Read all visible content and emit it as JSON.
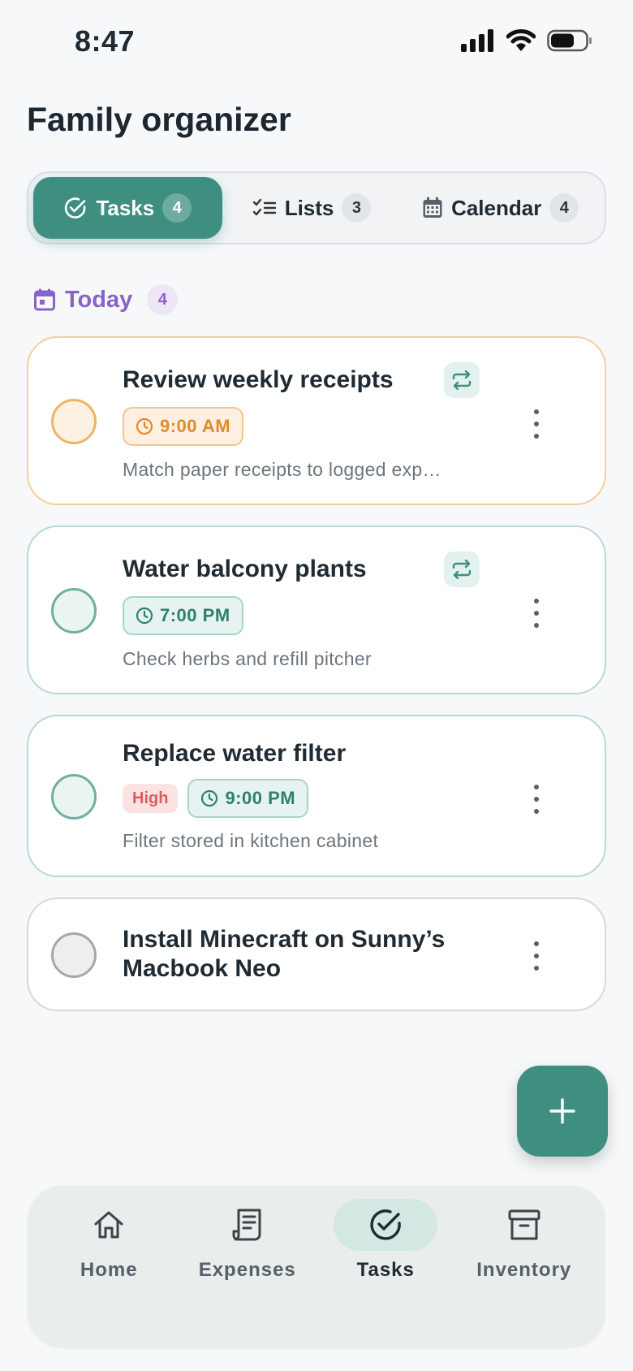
{
  "status_bar": {
    "time": "8:47"
  },
  "header": {
    "title": "Family organizer"
  },
  "segments": [
    {
      "label": "Tasks",
      "count": "4",
      "icon": "check-circle-icon",
      "active": true
    },
    {
      "label": "Lists",
      "count": "3",
      "icon": "checklist-icon",
      "active": false
    },
    {
      "label": "Calendar",
      "count": "4",
      "icon": "calendar-icon",
      "active": false
    }
  ],
  "section": {
    "label": "Today",
    "count": "4",
    "icon": "calendar-icon",
    "color": "#8a63c8"
  },
  "tasks": [
    {
      "title": "Review weekly receipts",
      "time": "9:00 AM",
      "note": "Match paper receipts to logged exp…",
      "repeat": true,
      "accent": "orange"
    },
    {
      "title": "Water balcony plants",
      "time": "7:00 PM",
      "note": "Check herbs and refill pitcher",
      "repeat": true,
      "accent": "teal"
    },
    {
      "title": "Replace water filter",
      "priority": "High",
      "time": "9:00 PM",
      "note": "Filter stored in kitchen cabinet",
      "repeat": false,
      "accent": "teal"
    },
    {
      "title_line1": "Install Minecraft on Sunny’s",
      "title_line2": "Macbook Neo",
      "accent": "gray"
    }
  ],
  "fab": {
    "icon": "plus-icon"
  },
  "tabbar": [
    {
      "label": "Home",
      "icon": "home-icon",
      "active": false
    },
    {
      "label": "Expenses",
      "icon": "receipt-icon",
      "active": false
    },
    {
      "label": "Tasks",
      "icon": "check-circle-icon",
      "active": true
    },
    {
      "label": "Inventory",
      "icon": "archive-box-icon",
      "active": false
    }
  ],
  "colors": {
    "primary": "#3e8f7f",
    "orange": "#e08a2e",
    "danger": "#e05b5b"
  }
}
